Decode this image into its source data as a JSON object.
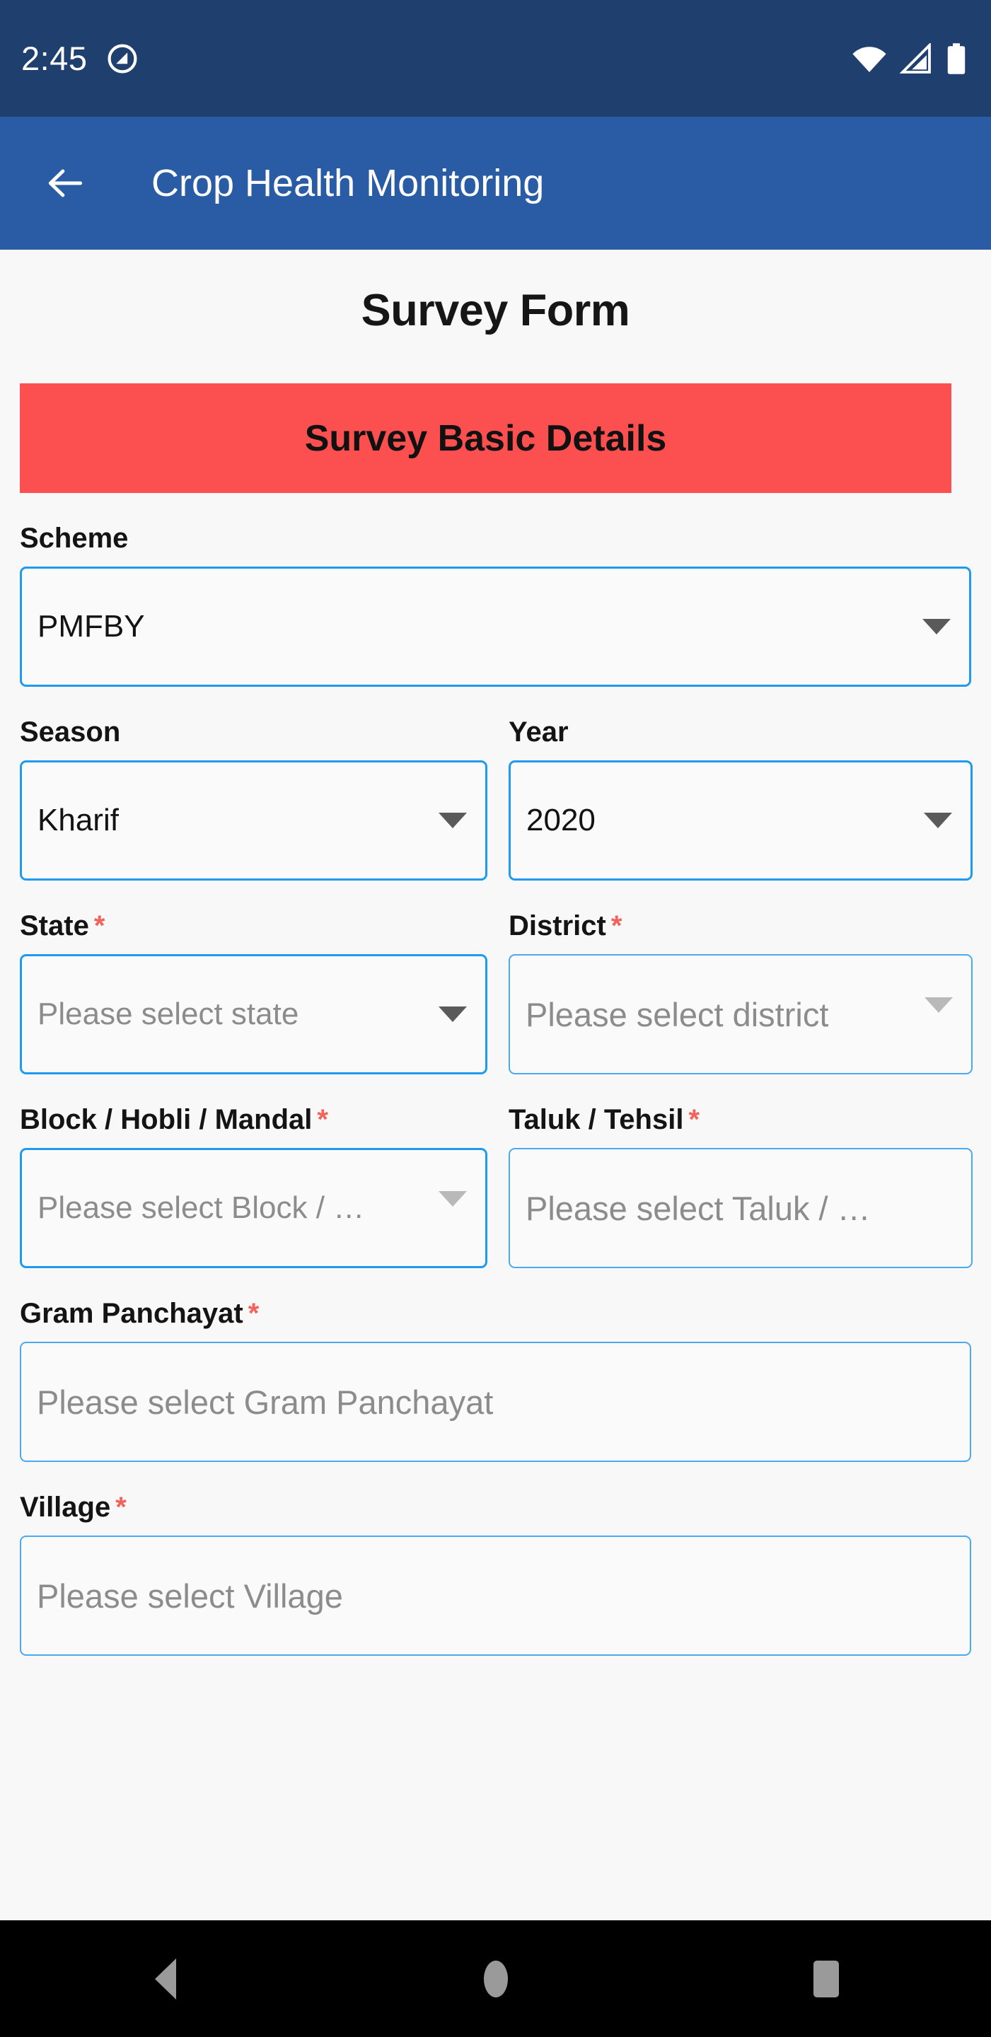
{
  "status_bar": {
    "clock": "2:45",
    "icons": {
      "dnd": "do-not-disturb-icon",
      "wifi": "wifi-icon",
      "signal": "cellular-signal-icon",
      "battery": "battery-icon"
    }
  },
  "app_bar": {
    "back_icon": "back-arrow-icon",
    "title": "Crop Health Monitoring"
  },
  "page": {
    "title": "Survey Form",
    "section_banner": "Survey Basic Details"
  },
  "fields": {
    "scheme": {
      "label": "Scheme",
      "value": "PMFBY",
      "placeholder": "",
      "required": false
    },
    "season": {
      "label": "Season",
      "value": "Kharif",
      "placeholder": "",
      "required": false
    },
    "year": {
      "label": "Year",
      "value": "2020",
      "placeholder": "",
      "required": false
    },
    "state": {
      "label": "State",
      "value": "",
      "placeholder": "Please select state",
      "required": true,
      "required_mark": "*"
    },
    "district": {
      "label": "District",
      "value": "",
      "placeholder": "Please select district",
      "required": true,
      "required_mark": "*"
    },
    "block": {
      "label": "Block / Hobli / Mandal",
      "value": "",
      "placeholder": "Please select Block / …",
      "required": true,
      "required_mark": "*"
    },
    "taluk": {
      "label": "Taluk / Tehsil",
      "value": "",
      "placeholder": "Please select Taluk / …",
      "required": true,
      "required_mark": "*"
    },
    "gram_panchayat": {
      "label": "Gram Panchayat",
      "value": "",
      "placeholder": "Please select Gram Panchayat",
      "required": true,
      "required_mark": "*"
    },
    "village": {
      "label": "Village",
      "value": "",
      "placeholder": "Please select Village",
      "required": true,
      "required_mark": "*"
    }
  },
  "nav_bar": {
    "back": "android-back-icon",
    "home": "android-home-icon",
    "recents": "android-recents-icon"
  },
  "colors": {
    "status_bar": "#1F3F6E",
    "app_bar": "#2A5CA5",
    "banner": "#FC5050",
    "field_border": "#1E9BF0",
    "required": "#F2635C",
    "background": "#F8F8F8"
  }
}
